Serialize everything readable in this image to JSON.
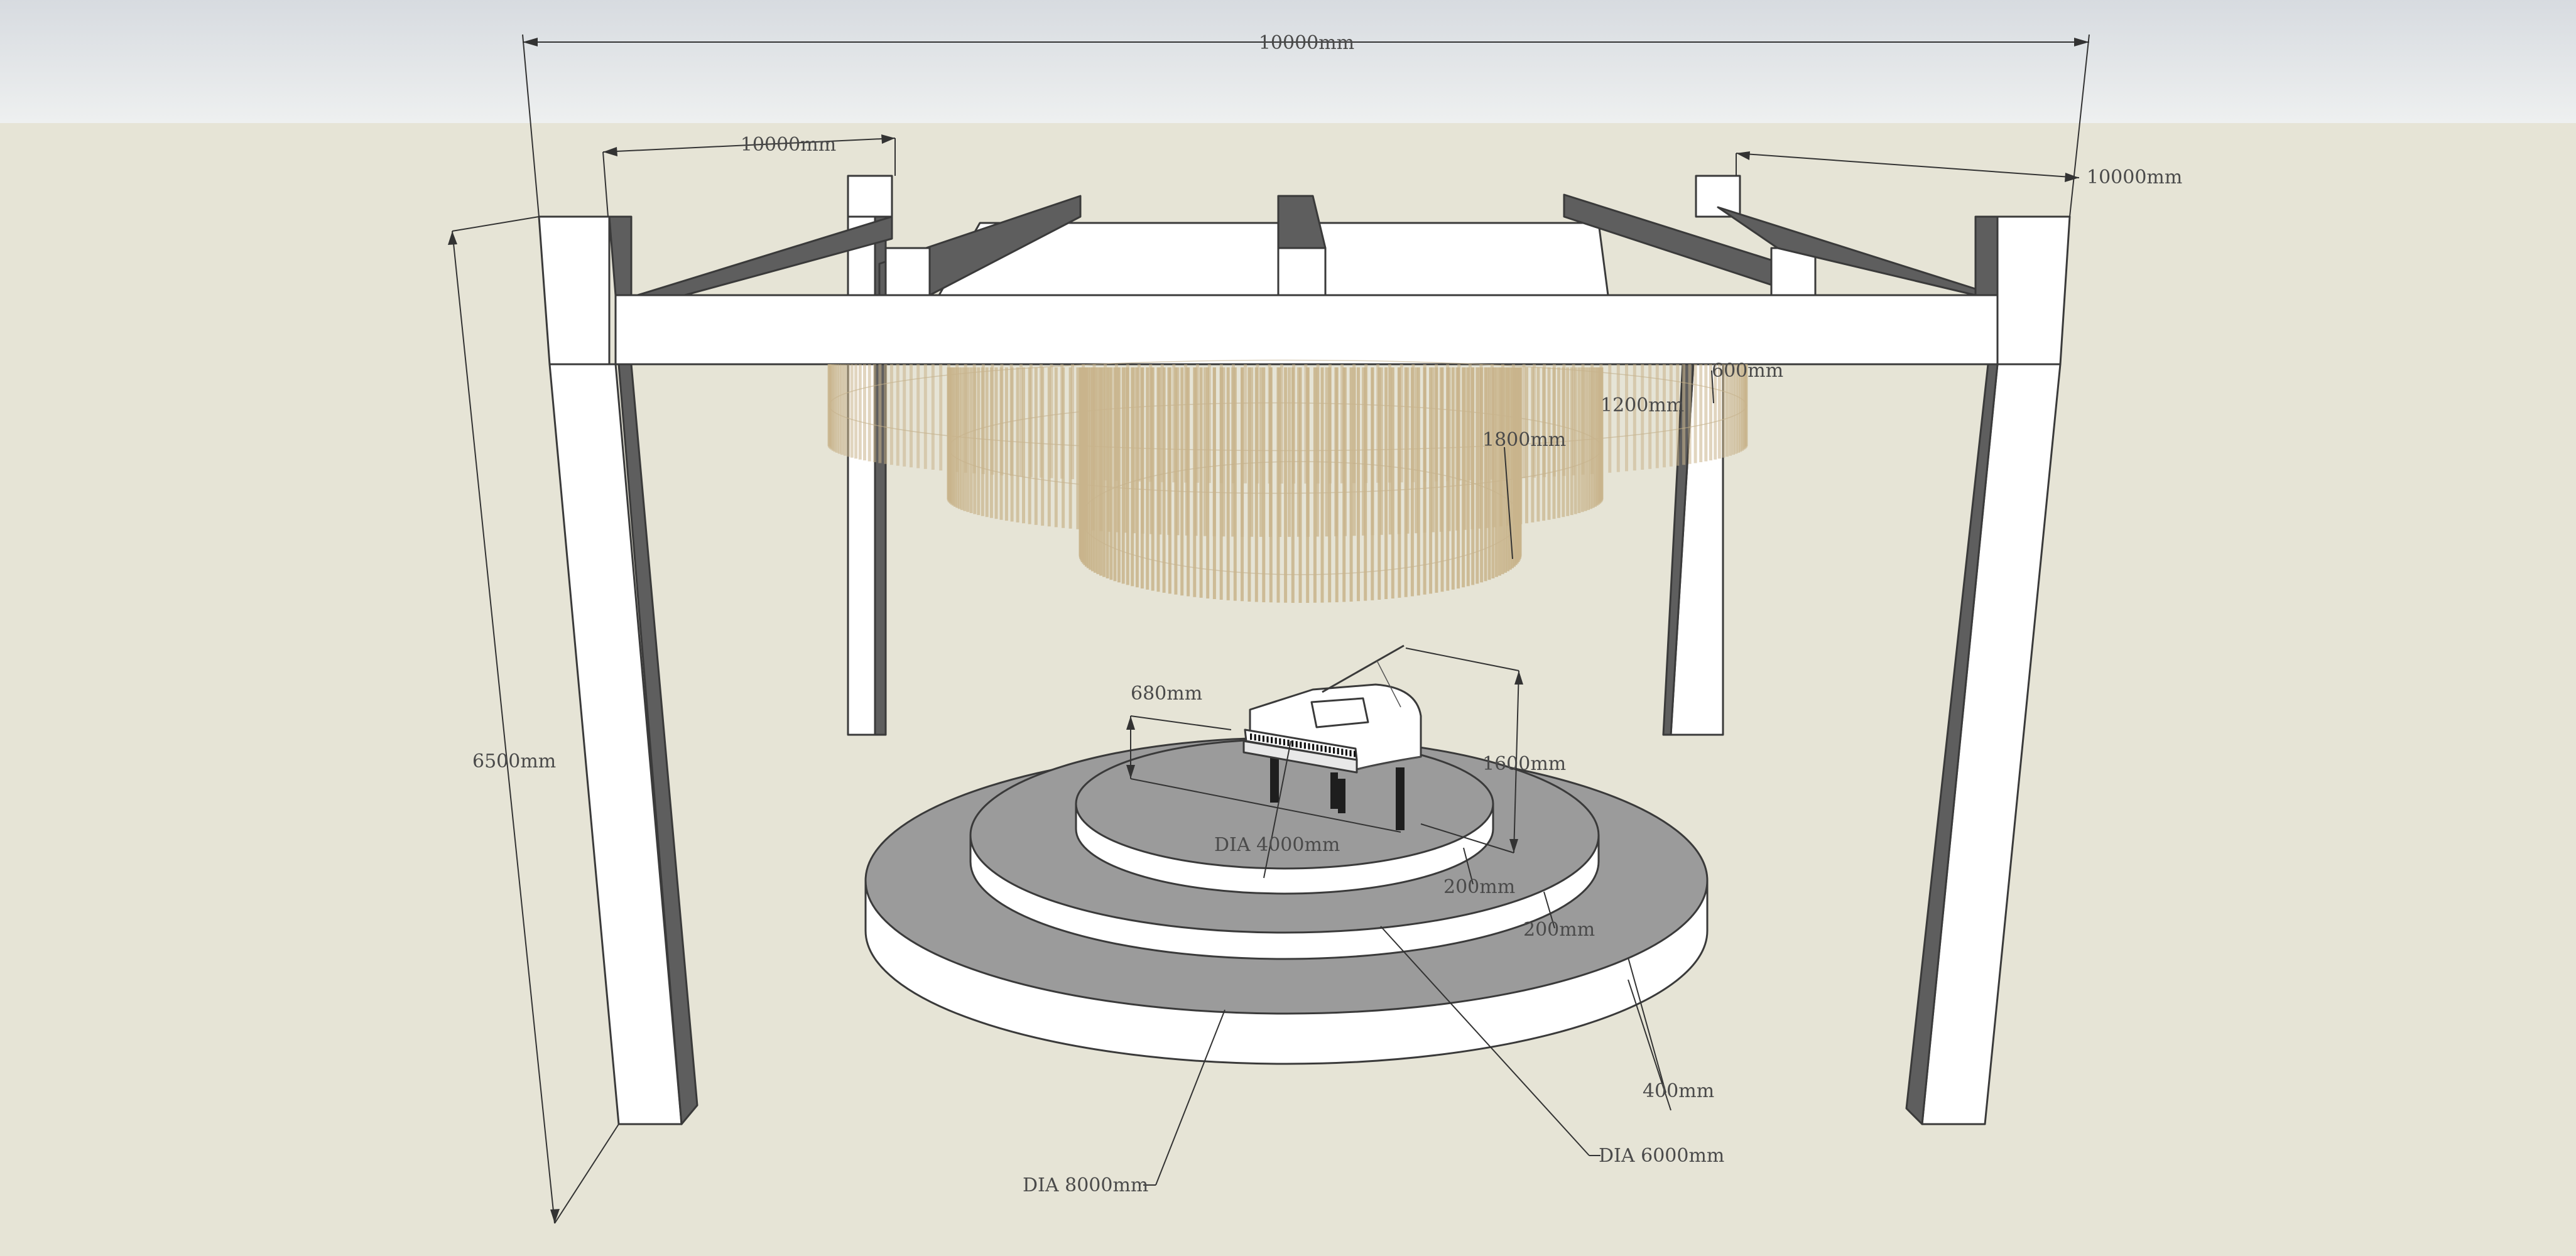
{
  "colors": {
    "sky": "#dde0e4",
    "ground": "#e6e4d6",
    "wall_light": "#ffffff",
    "wall_dark": "#5e5e5e",
    "stage_top": "#9b9b9b",
    "rods": "#c9b48c"
  },
  "dimensions": {
    "top_width": "10000mm",
    "left_depth": "10000mm",
    "right_depth": "10000mm",
    "height": "6500mm",
    "chandelier_inner": "600mm",
    "chandelier_mid": "1200mm",
    "chandelier_outer": "1800mm",
    "piano_height_left": "680mm",
    "piano_height_right": "1600mm",
    "tier_top_dia": "DIA 4000mm",
    "tier_top_step": "200mm",
    "tier_mid_step": "200mm",
    "tier_base_step": "400mm",
    "tier_mid_dia": "DIA 6000mm",
    "tier_base_dia": "DIA 8000mm"
  },
  "objects": {
    "frame": "frame-structure",
    "chandelier": "chandelier",
    "stage": "stage",
    "piano": "grand-piano"
  }
}
